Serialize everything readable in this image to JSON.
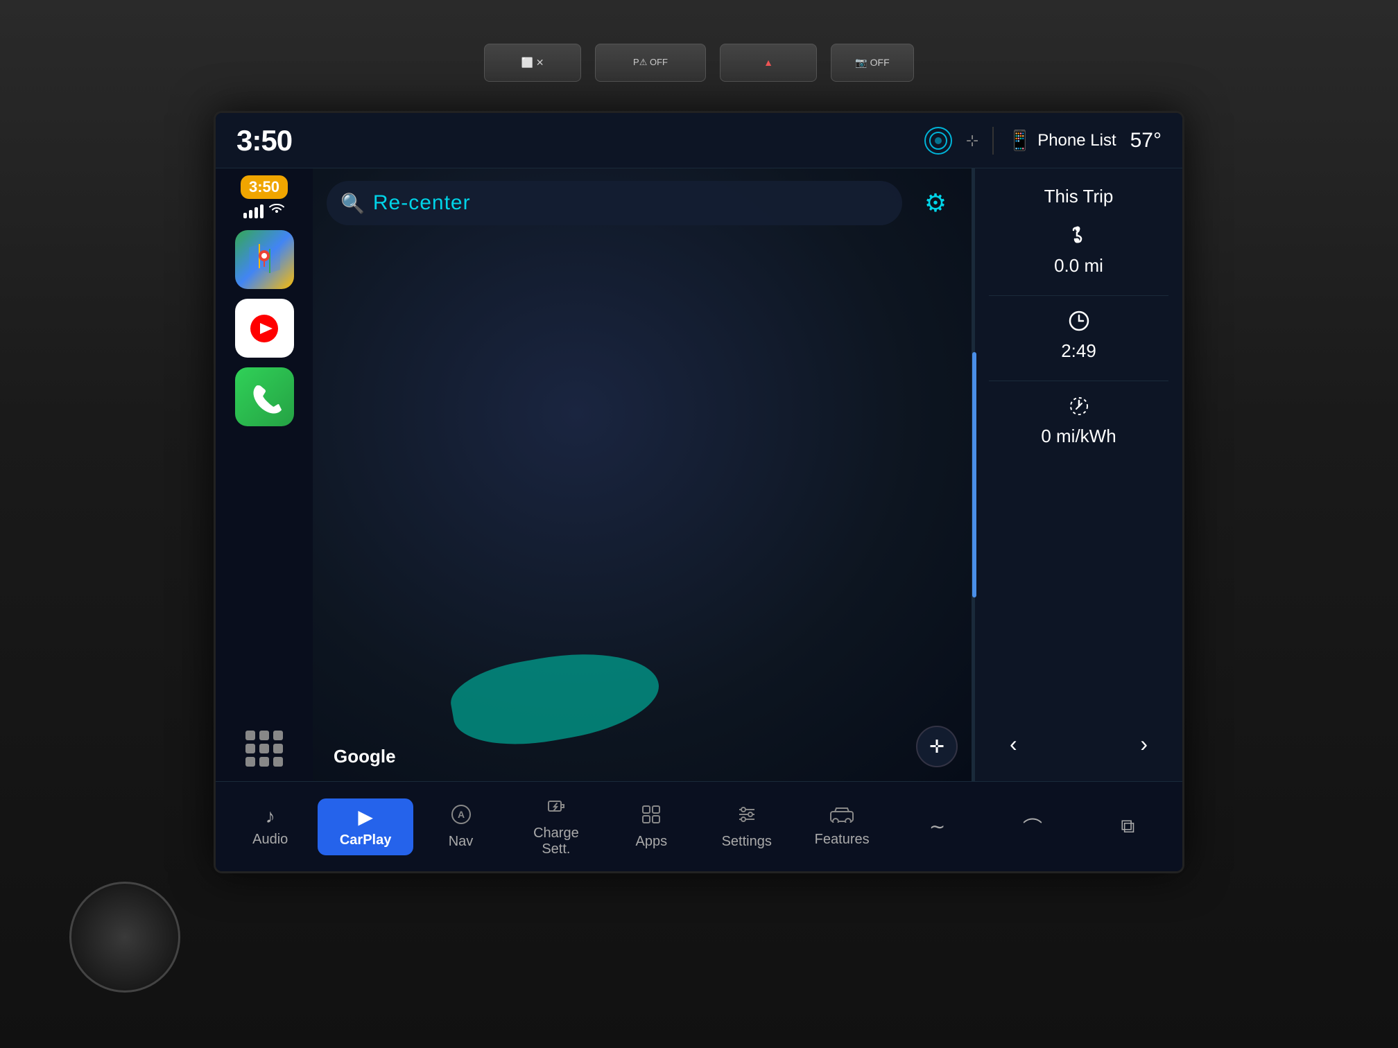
{
  "car": {
    "bg_color": "#1a1a1a"
  },
  "status_bar": {
    "time": "3:50",
    "alexa_label": "Alexa",
    "phone_label": "Phone List",
    "temperature": "57°"
  },
  "carplay": {
    "sidebar": {
      "time_badge": "3:50",
      "apps": [
        {
          "id": "maps",
          "label": "Google Maps"
        },
        {
          "id": "youtube",
          "label": "YouTube Music"
        },
        {
          "id": "phone",
          "label": "Phone"
        }
      ],
      "grid_label": "All Apps"
    },
    "search_bar": {
      "placeholder": "Re-center",
      "text": "Re-center"
    },
    "google_watermark": "Google"
  },
  "trip_panel": {
    "title": "This Trip",
    "items": [
      {
        "icon": "route",
        "value": "0.0 mi"
      },
      {
        "icon": "clock",
        "value": "2:49"
      },
      {
        "icon": "efficiency",
        "value": "0 mi/kWh"
      }
    ]
  },
  "bottom_nav": {
    "items": [
      {
        "id": "audio",
        "label": "Audio",
        "icon": "music",
        "active": false
      },
      {
        "id": "carplay",
        "label": "CarPlay",
        "icon": "play",
        "active": true
      },
      {
        "id": "nav",
        "label": "Nav",
        "icon": "nav",
        "active": false
      },
      {
        "id": "charge",
        "label": "Charge Sett.",
        "icon": "charge",
        "active": false
      },
      {
        "id": "apps",
        "label": "Apps",
        "icon": "apps",
        "active": false
      },
      {
        "id": "settings",
        "label": "Settings",
        "icon": "settings",
        "active": false
      },
      {
        "id": "features",
        "label": "Features",
        "icon": "features",
        "active": false
      },
      {
        "id": "tilde1",
        "label": "",
        "icon": "down1",
        "active": false
      },
      {
        "id": "tilde2",
        "label": "",
        "icon": "down2",
        "active": false
      },
      {
        "id": "copy",
        "label": "",
        "icon": "copy",
        "active": false
      }
    ]
  },
  "top_buttons": [
    {
      "id": "screen",
      "label": "⬜ ✕"
    },
    {
      "id": "parking",
      "label": "P⚠ OFF"
    },
    {
      "id": "hazard",
      "label": "▲"
    },
    {
      "id": "camera",
      "label": "📷 OFF"
    }
  ]
}
